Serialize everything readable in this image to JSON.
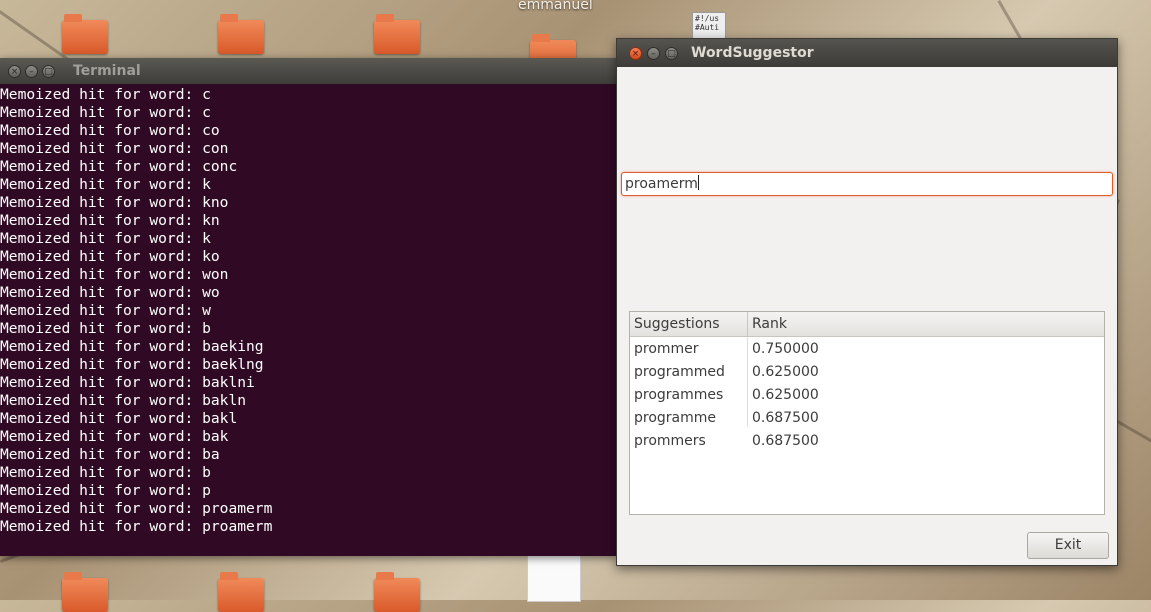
{
  "desktop": {
    "user_label": "emmanuel",
    "script_icon_text": "#!/us\n#Auti"
  },
  "terminal": {
    "title": "Terminal",
    "lines": [
      "Memoized hit for word: c",
      "Memoized hit for word: c",
      "Memoized hit for word: co",
      "Memoized hit for word: con",
      "Memoized hit for word: conc",
      "Memoized hit for word: k",
      "Memoized hit for word: kno",
      "Memoized hit for word: kn",
      "Memoized hit for word: k",
      "Memoized hit for word: ko",
      "Memoized hit for word: won",
      "Memoized hit for word: wo",
      "Memoized hit for word: w",
      "Memoized hit for word: b",
      "Memoized hit for word: baeking",
      "Memoized hit for word: baeklng",
      "Memoized hit for word: baklni",
      "Memoized hit for word: bakln",
      "Memoized hit for word: bakl",
      "Memoized hit for word: bak",
      "Memoized hit for word: ba",
      "Memoized hit for word: b",
      "Memoized hit for word: p",
      "Memoized hit for word: proamerm",
      "Memoized hit for word: proamerm"
    ]
  },
  "word_suggestor": {
    "title": "WordSuggestor",
    "input_value": "proamerm",
    "table": {
      "headers": [
        "Suggestions",
        "Rank"
      ],
      "rows": [
        [
          "prommer",
          "0.750000"
        ],
        [
          "programmed",
          "0.625000"
        ],
        [
          "programmes",
          "0.625000"
        ],
        [
          "programme",
          "0.687500"
        ],
        [
          "prommers",
          "0.687500"
        ]
      ]
    },
    "exit_label": "Exit"
  },
  "colors": {
    "terminal_bg": "#300a24",
    "accent_focus": "#e05a2a",
    "close_button": "#e0602c"
  },
  "icons": {
    "window_close": "×",
    "window_minimize": "–",
    "window_maximize": "□"
  }
}
